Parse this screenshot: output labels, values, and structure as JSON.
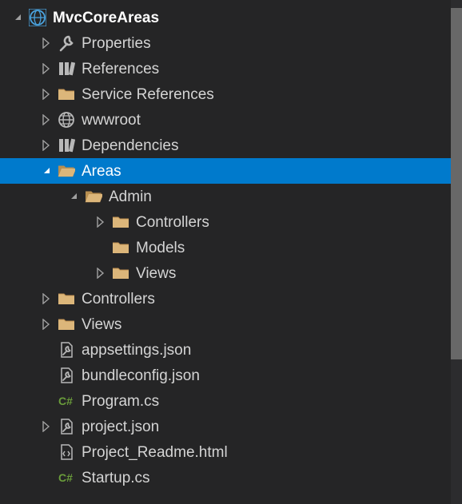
{
  "colors": {
    "background": "#252526",
    "selection": "#007acc",
    "folder": "#dcb67a",
    "text": "#d4d4d4",
    "white": "#ffffff",
    "cs": "#6a9c3b"
  },
  "tree": {
    "root": {
      "label": "MvcCoreAreas",
      "icon": "web-app-icon",
      "expanded": true,
      "bold": true,
      "indent": 16
    },
    "items": [
      {
        "label": "Properties",
        "icon": "wrench-icon",
        "expanded": false,
        "expandable": true,
        "indent": 52
      },
      {
        "label": "References",
        "icon": "references-icon",
        "expanded": false,
        "expandable": true,
        "indent": 52
      },
      {
        "label": "Service References",
        "icon": "folder-icon",
        "expanded": false,
        "expandable": true,
        "indent": 52
      },
      {
        "label": "wwwroot",
        "icon": "globe-icon",
        "expanded": false,
        "expandable": true,
        "indent": 52
      },
      {
        "label": "Dependencies",
        "icon": "references-icon",
        "expanded": false,
        "expandable": true,
        "indent": 52
      },
      {
        "label": "Areas",
        "icon": "folder-open-icon",
        "expanded": true,
        "expandable": true,
        "selected": true,
        "indent": 52
      },
      {
        "label": "Admin",
        "icon": "folder-open-icon",
        "expanded": true,
        "expandable": true,
        "indent": 86
      },
      {
        "label": "Controllers",
        "icon": "folder-icon",
        "expanded": false,
        "expandable": true,
        "indent": 120
      },
      {
        "label": "Models",
        "icon": "folder-icon",
        "expanded": false,
        "expandable": false,
        "indent": 120
      },
      {
        "label": "Views",
        "icon": "folder-icon",
        "expanded": false,
        "expandable": true,
        "indent": 120
      },
      {
        "label": "Controllers",
        "icon": "folder-icon",
        "expanded": false,
        "expandable": true,
        "indent": 52
      },
      {
        "label": "Views",
        "icon": "folder-icon",
        "expanded": false,
        "expandable": true,
        "indent": 52
      },
      {
        "label": "appsettings.json",
        "icon": "json-icon",
        "expanded": false,
        "expandable": false,
        "indent": 52
      },
      {
        "label": "bundleconfig.json",
        "icon": "json-icon",
        "expanded": false,
        "expandable": false,
        "indent": 52
      },
      {
        "label": "Program.cs",
        "icon": "cs-icon",
        "expanded": false,
        "expandable": false,
        "indent": 52
      },
      {
        "label": "project.json",
        "icon": "json-icon",
        "expanded": false,
        "expandable": true,
        "indent": 52
      },
      {
        "label": "Project_Readme.html",
        "icon": "html-icon",
        "expanded": false,
        "expandable": false,
        "indent": 52
      },
      {
        "label": "Startup.cs",
        "icon": "cs-icon",
        "expanded": false,
        "expandable": false,
        "indent": 52
      }
    ]
  }
}
